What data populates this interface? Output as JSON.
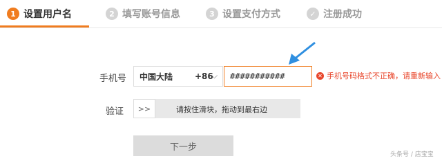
{
  "steps": [
    {
      "num": "1",
      "label": "设置用户名"
    },
    {
      "num": "2",
      "label": "填写账号信息"
    },
    {
      "num": "3",
      "label": "设置支付方式"
    },
    {
      "num": "✓",
      "label": "注册成功"
    }
  ],
  "form": {
    "phone_label": "手机号",
    "country": "中国大陆",
    "country_code": "+86",
    "phone_value": "###########",
    "error_text": "手机号码格式不正确，请重新输入",
    "verify_label": "验证",
    "slider_handle": ">>",
    "slider_hint": "请按住滑块，拖动到最右边",
    "next_button": "下一步"
  },
  "watermark": "头条号 / 店宝宝",
  "colors": {
    "accent": "#f07c1f",
    "error": "#e8462b",
    "inactive": "#d4d4d4"
  }
}
